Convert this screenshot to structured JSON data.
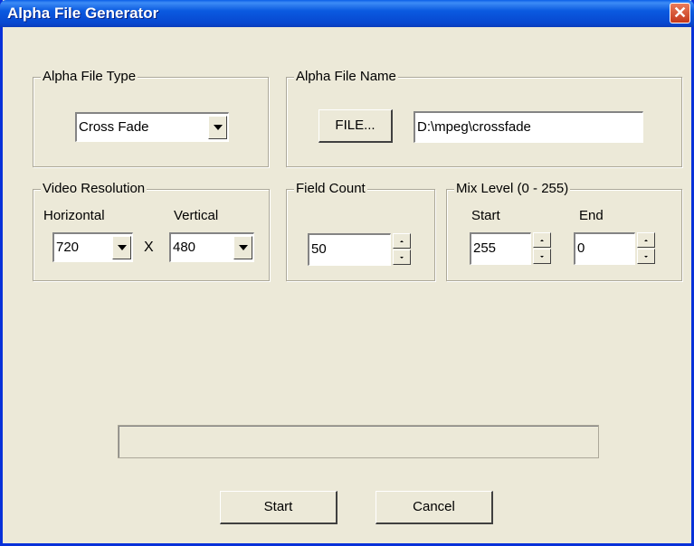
{
  "window": {
    "title": "Alpha File Generator",
    "close_glyph": "✕"
  },
  "alpha_type": {
    "legend": "Alpha File Type",
    "selected": "Cross Fade"
  },
  "alpha_name": {
    "legend": "Alpha File Name",
    "file_button": "FILE...",
    "path": "D:\\mpeg\\crossfade"
  },
  "resolution": {
    "legend": "Video Resolution",
    "h_label": "Horizontal",
    "v_label": "Vertical",
    "h_value": "720",
    "v_value": "480",
    "separator": "X"
  },
  "field_count": {
    "legend": "Field Count",
    "value": "50"
  },
  "mix_level": {
    "legend": "Mix Level (0 - 255)",
    "start_label": "Start",
    "end_label": "End",
    "start_value": "255",
    "end_value": "0"
  },
  "progress": {
    "value": 0
  },
  "buttons": {
    "start": "Start",
    "cancel": "Cancel"
  },
  "colors": {
    "title_bar": "#0a5ae0",
    "window_bg": "#ece9d8",
    "close_button": "#d9572f"
  }
}
